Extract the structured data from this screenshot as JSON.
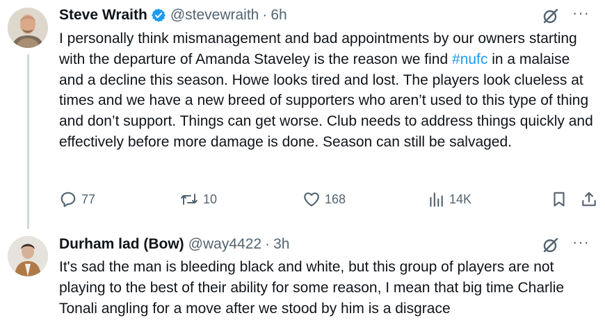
{
  "tweets": [
    {
      "author_name": "Steve Wraith",
      "handle": "@stevewraith",
      "separator": "·",
      "time": "6h",
      "verified": true,
      "text_before_hashtag": "I personally think mismanagement and bad appointments by our owners starting with the departure of Amanda Staveley is the reason we find ",
      "hashtag": "#nufc",
      "text_after_hashtag": " in a malaise and a decline this season. Howe looks tired and lost. The players look clueless at times and we have a new breed of supporters who aren’t used to this type of thing and don’t support. Things can get worse. Club needs to address things quickly and effectively before more damage is done. Season can still be salvaged.",
      "stats": {
        "replies": "77",
        "reposts": "10",
        "likes": "168",
        "views": "14K"
      }
    },
    {
      "author_name": "Durham lad (Bow)",
      "handle": "@way4422",
      "separator": "·",
      "time": "3h",
      "verified": false,
      "text": "It's sad the man is bleeding black and white, but this group of players are not playing to the best of their ability for some reason, I mean that big time Charlie Tonali angling for a move after we stood by him is a disgrace"
    }
  ],
  "colors": {
    "text": "#0f1419",
    "muted": "#536471",
    "link": "#1d9bf0",
    "verified": "#1d9bf0",
    "thread_line": "#cfd9de"
  },
  "icons": {
    "grok": "grok-icon",
    "more": "more-icon",
    "reply": "reply-icon",
    "repost": "repost-icon",
    "like": "heart-icon",
    "views": "views-icon",
    "bookmark": "bookmark-icon",
    "share": "share-icon",
    "verified": "verified-badge-icon"
  }
}
